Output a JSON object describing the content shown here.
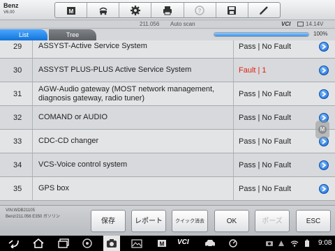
{
  "header": {
    "make": "Benz",
    "version": "V6.00"
  },
  "toolbar": {
    "items": [
      {
        "name": "home-icon",
        "enabled": true
      },
      {
        "name": "vehicle-swap-icon",
        "enabled": true
      },
      {
        "name": "settings-icon",
        "enabled": true
      },
      {
        "name": "print-icon",
        "enabled": true
      },
      {
        "name": "help-icon",
        "enabled": false
      },
      {
        "name": "save-icon",
        "enabled": true
      },
      {
        "name": "pen-icon",
        "enabled": true
      }
    ]
  },
  "statusline": {
    "software_version": "211.056",
    "mode": "Auto scan",
    "vci_label": "VCI",
    "voltage": "14.14V"
  },
  "tabs": {
    "list": "List",
    "tree": "Tree"
  },
  "scan": {
    "progress_percent": 100,
    "progress_label": "100%"
  },
  "rows": [
    {
      "num": "29",
      "name": "ASSYST-Active Service System",
      "status": "Pass | No Fault",
      "fault": false
    },
    {
      "num": "30",
      "name": "ASSYST PLUS-PLUS Active Service System",
      "status": "Fault | 1",
      "fault": true
    },
    {
      "num": "31",
      "name": "AGW-Audio gateway (MOST network management, diagnosis gateway, radio tuner)",
      "status": "Pass | No Fault",
      "fault": false
    },
    {
      "num": "32",
      "name": "COMAND or AUDIO",
      "status": "Pass | No Fault",
      "fault": false
    },
    {
      "num": "33",
      "name": "CDC-CD changer",
      "status": "Pass | No Fault",
      "fault": false
    },
    {
      "num": "34",
      "name": "VCS-Voice control system",
      "status": "Pass | No Fault",
      "fault": false
    },
    {
      "num": "35",
      "name": "GPS box",
      "status": "Pass | No Fault",
      "fault": false
    }
  ],
  "float_button": "M",
  "vehicle_info": {
    "vin": "VIN:WDB21105",
    "model": "Benz/211.056 E350 ガソリン"
  },
  "buttons": {
    "save": "保存",
    "report": "レポート",
    "quick_clear": "クイック消去",
    "ok": "OK",
    "pause": "ポーズ",
    "esc": "ESC"
  },
  "android": {
    "clock": "9:08",
    "vci_label": "VCI"
  },
  "colors": {
    "accent": "#1a78e0",
    "fault": "#e02010"
  }
}
